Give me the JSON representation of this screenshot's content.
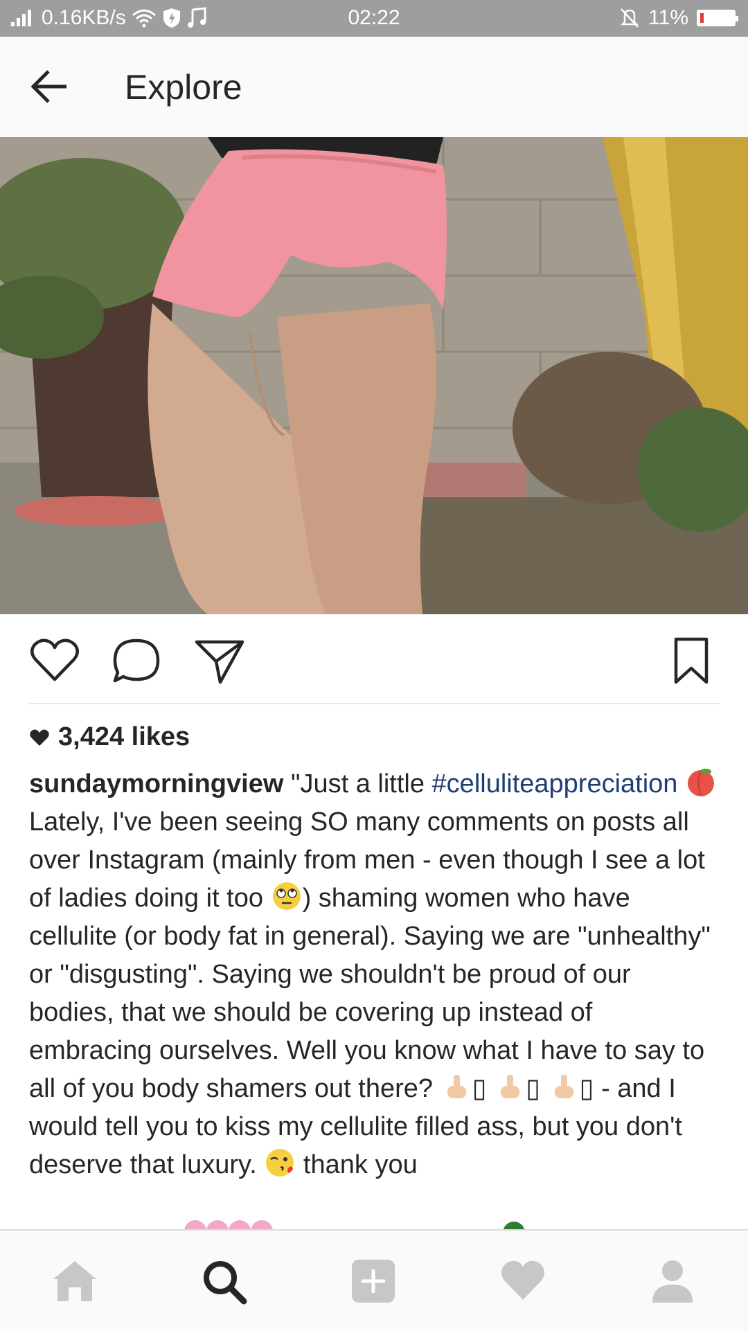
{
  "status_bar": {
    "network_speed": "0.16KB/s",
    "time": "02:22",
    "battery_percent": "11%",
    "battery_level": 0.11,
    "icons": [
      "signal-icon",
      "wifi-icon",
      "shield-icon",
      "music-note-icon",
      "bell-muted-icon",
      "battery-icon"
    ]
  },
  "header": {
    "title": "Explore",
    "back_icon": "arrow-left-icon"
  },
  "post": {
    "image_description": "photo",
    "actions": [
      "heart-icon",
      "comment-icon",
      "share-icon",
      "bookmark-icon"
    ],
    "likes_text": "3,424 likes",
    "username": "sundaymorningview",
    "caption_start": "\"Just a little",
    "hashtag": "#celluliteappreciation",
    "caption_body_1": "Lately, I've been seeing SO many comments on posts all over Instagram (mainly from men - even though I see a lot of ladies doing it too",
    "caption_body_2": ") shaming women who have cellulite (or body fat in general). Saying we are \"unhealthy\" or \"disgusting\". Saying we shouldn't be proud of our bodies, that we should be covering up instead of embracing ourselves. Well you know what I have to say to all of you body shamers out there?",
    "caption_body_3": "- and I would tell you to kiss my cellulite filled ass, but you don't deserve that luxury.",
    "caption_body_4": "thank you",
    "missing_glyph": "▯"
  },
  "bottom_nav": [
    "home-icon",
    "search-icon",
    "add-icon",
    "activity-heart-icon",
    "profile-icon"
  ],
  "colors": {
    "status_bar": "#9e9e9e",
    "hashtag": "#1e3e73",
    "active_nav": "#262626",
    "inactive_nav": "#c7c7c7"
  }
}
